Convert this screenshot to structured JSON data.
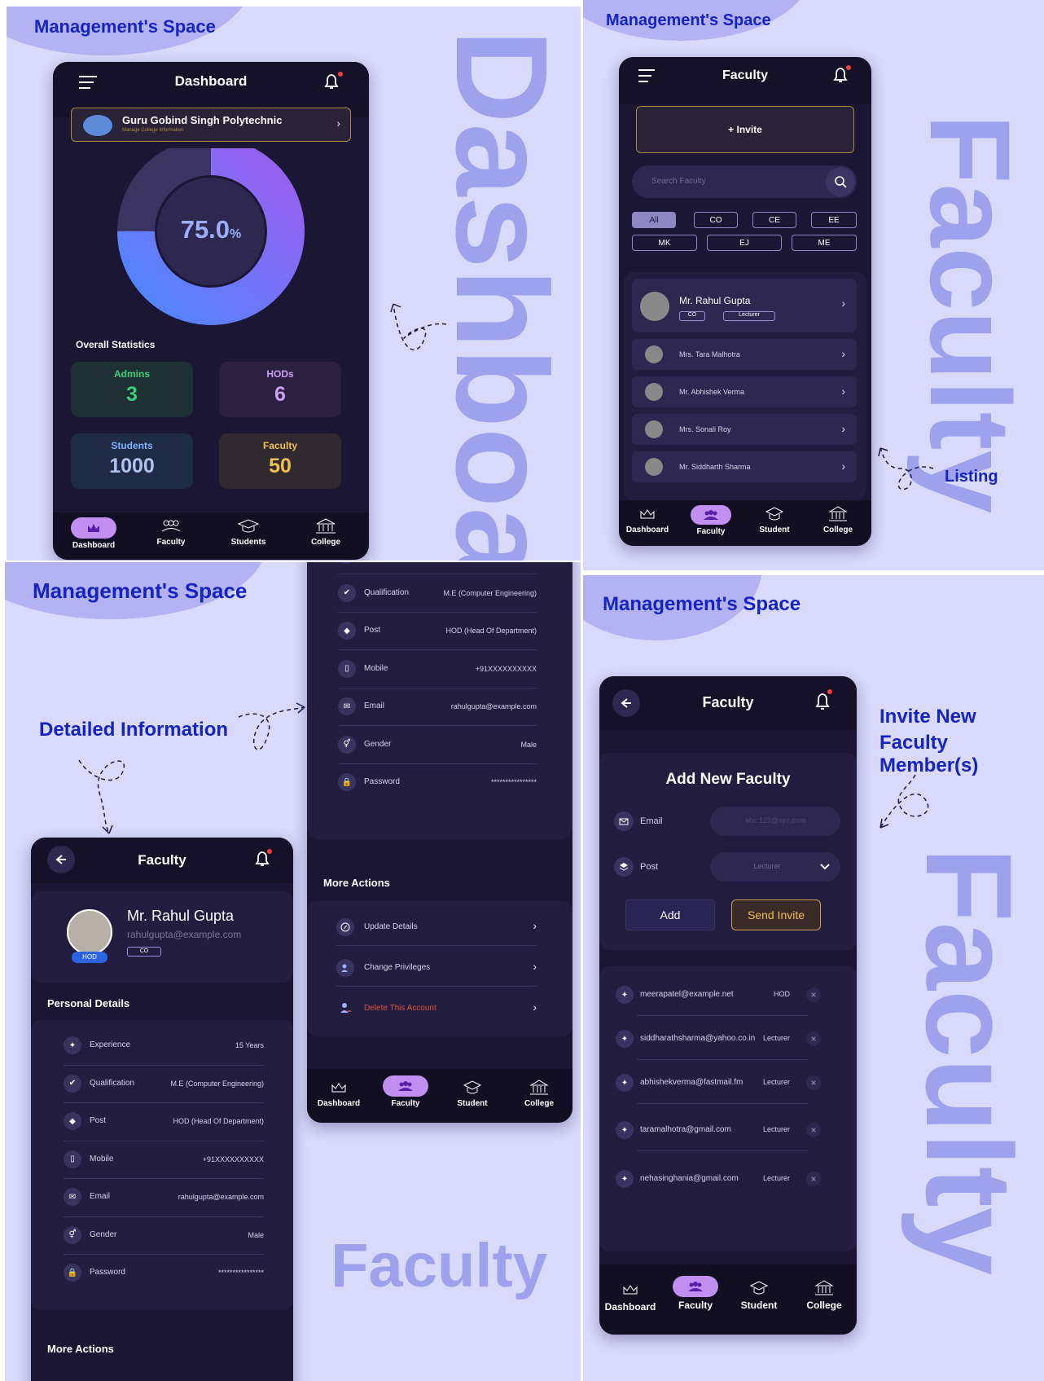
{
  "brand": {
    "space_title": "Management's Space"
  },
  "colors": {
    "bg": "#d9d9fb",
    "accent": "#1523c2",
    "phone_bg": "#1b1634",
    "pill": "#c18ff2",
    "ring": "#6a6cf0"
  },
  "nav": {
    "dashboard": "Dashboard",
    "faculty": "Faculty",
    "students": "Students",
    "student": "Student",
    "college": "College",
    "icons": [
      "crown-icon",
      "people-icon",
      "graduation-cap-icon",
      "building-icon"
    ]
  },
  "dashboard": {
    "big_word": "Dashboard",
    "header_title": "Dashboard",
    "college_name": "Guru Gobind Singh Polytechnic",
    "college_sub": "Manage College Information",
    "progress": "75.0",
    "progress_unit": "%",
    "progress_fraction": 0.75,
    "stats_title": "Overall Statistics",
    "stats": [
      {
        "label": "Admins",
        "value": "3",
        "color": "#3ccf7a"
      },
      {
        "label": "HODs",
        "value": "6",
        "color": "#c9a0f0"
      },
      {
        "label": "Students",
        "value": "1000",
        "color": "#7fb3ff"
      },
      {
        "label": "Faculty",
        "value": "50",
        "color": "#f0c050"
      }
    ]
  },
  "listing": {
    "big_word": "Faculty",
    "side_label": "Listing",
    "header_title": "Faculty",
    "invite_label": "+ Invite",
    "search_placeholder": "Search Faculty",
    "filters_row1": [
      "All",
      "CO",
      "CE",
      "EE"
    ],
    "filters_row2": [
      "MK",
      "EJ",
      "ME"
    ],
    "featured": {
      "name": "Mr. Rahul Gupta",
      "dept": "CO",
      "role": "Lecturer"
    },
    "items": [
      "Mrs. Tara Malhotra",
      "Mr. Abhishek Verma",
      "Mrs. Sonali Roy",
      "Mr. Siddharth Sharma"
    ]
  },
  "detail": {
    "side_label": "Detailed Information",
    "big_word": "Faculty",
    "header_title": "Faculty",
    "name": "Mr. Rahul Gupta",
    "email": "rahulgupta@example.com",
    "badge": "HOD",
    "dept": "CO",
    "personal_title": "Personal Details",
    "more_title": "More Actions",
    "fields": [
      {
        "label": "Experience",
        "value": "15 Years",
        "icon": "sparkle-icon"
      },
      {
        "label": "Qualification",
        "value": "M.E (Computer Engineering)",
        "icon": "verified-icon"
      },
      {
        "label": "Post",
        "value": "HOD (Head Of Department)",
        "icon": "layers-icon"
      },
      {
        "label": "Mobile",
        "value": "+91XXXXXXXXXX",
        "icon": "phone-icon"
      },
      {
        "label": "Email",
        "value": "rahulgupta@example.com",
        "icon": "mail-icon"
      },
      {
        "label": "Gender",
        "value": "Male",
        "icon": "gender-icon"
      },
      {
        "label": "Password",
        "value": "****************",
        "icon": "lock-icon"
      }
    ],
    "actions": [
      {
        "label": "Update Details",
        "color": "#d6d3ea"
      },
      {
        "label": "Change Privileges",
        "color": "#d6d3ea"
      },
      {
        "label": "Delete This Account",
        "color": "#e0503a"
      }
    ]
  },
  "invite": {
    "side_label_1": "Invite New",
    "side_label_2": "Faculty Member(s)",
    "big_word": "Faculty",
    "header_title": "Faculty",
    "form_title": "Add New Faculty",
    "email_label": "Email",
    "email_placeholder": "abc.123@xyz.com",
    "post_label": "Post",
    "post_value": "Lecturer",
    "add_label": "Add",
    "send_label": "Send Invite",
    "remove_symbol": "×",
    "invites": [
      {
        "email": "meerapatel@example.net",
        "role": "HOD"
      },
      {
        "email": "siddharathsharma@yahoo.co.in",
        "role": "Lecturer"
      },
      {
        "email": "abhishekverma@fastmail.fm",
        "role": "Lecturer"
      },
      {
        "email": "taramalhotra@gmail.com",
        "role": "Lecturer"
      },
      {
        "email": "nehasinghania@gmail.com",
        "role": "Lecturer"
      }
    ]
  }
}
